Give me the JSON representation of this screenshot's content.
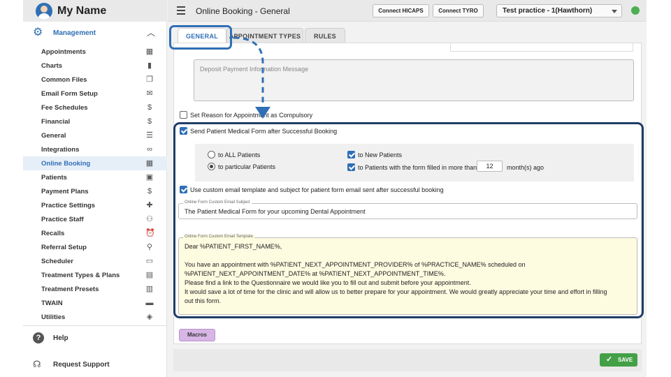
{
  "user": {
    "name": "My Name"
  },
  "sidebar": {
    "section_label": "Management",
    "items": [
      {
        "label": "Appointments",
        "icon": "calendar-icon"
      },
      {
        "label": "Charts",
        "icon": "bar-chart-icon"
      },
      {
        "label": "Common Files",
        "icon": "files-icon"
      },
      {
        "label": "Email Form Setup",
        "icon": "envelope-open-icon"
      },
      {
        "label": "Fee Schedules",
        "icon": "dollar-box-icon"
      },
      {
        "label": "Financial",
        "icon": "dollar-icon"
      },
      {
        "label": "General",
        "icon": "sliders-icon"
      },
      {
        "label": "Integrations",
        "icon": "link-icon"
      },
      {
        "label": "Online Booking",
        "icon": "calendar-icon",
        "active": true
      },
      {
        "label": "Patients",
        "icon": "contact-icon"
      },
      {
        "label": "Payment Plans",
        "icon": "dollar-icon"
      },
      {
        "label": "Practice Settings",
        "icon": "first-aid-icon"
      },
      {
        "label": "Practice Staff",
        "icon": "people-icon"
      },
      {
        "label": "Recalls",
        "icon": "alarm-icon"
      },
      {
        "label": "Referral Setup",
        "icon": "stamp-icon"
      },
      {
        "label": "Scheduler",
        "icon": "calendar-blank-icon"
      },
      {
        "label": "Treatment Types & Plans",
        "icon": "clipboard-icon"
      },
      {
        "label": "Treatment Presets",
        "icon": "list-box-icon"
      },
      {
        "label": "TWAIN",
        "icon": "scanner-icon"
      },
      {
        "label": "Utilities",
        "icon": "widgets-icon"
      }
    ],
    "help_label": "Help",
    "support_label": "Request Support"
  },
  "header": {
    "title": "Online Booking - General",
    "hicaps_label": "Connect HICAPS",
    "tyro_label": "Connect TYRO",
    "practice_selected": "Test practice - 1(Hawthorn)"
  },
  "tabs": [
    {
      "label": "GENERAL",
      "active": true
    },
    {
      "label": "APPOINTMENT TYPES",
      "active": false
    },
    {
      "label": "RULES",
      "active": false
    }
  ],
  "form": {
    "deposit_placeholder": "Deposit Payment Information Message",
    "set_reason_label": "Set Reason for Appointment as Compulsory",
    "set_reason_checked": false,
    "send_form_label": "Send Patient Medical Form after Successful Booking",
    "send_form_checked": true,
    "radio_all_label": "to ALL Patients",
    "radio_particular_label": "to particular Patients",
    "radio_selected": "particular",
    "new_patients_label": "to New Patients",
    "new_patients_checked": true,
    "filled_label": "to Patients with the form filled in more than",
    "filled_checked": true,
    "months_value": "12",
    "months_suffix": "month(s) ago",
    "custom_template_label": "Use custom email template and subject for patient form email sent after successful booking",
    "custom_template_checked": true,
    "subject_field_label": "Online Form Custom Email Subject",
    "subject_value": "The Patient Medical Form for your upcoming Dental Appointment",
    "template_field_label": "Online Form Custom Email Template",
    "template_lines": {
      "l1": "Dear %PATIENT_FIRST_NAME%,",
      "l2": "You have an appointment with %PATIENT_NEXT_APPOINTMENT_PROVIDER% of %PRACTICE_NAME% scheduled on",
      "l3": "%PATIENT_NEXT_APPOINTMENT_DATE% at %PATIENT_NEXT_APPOINTMENT_TIME%.",
      "l4": "Please find a link to the Questionnaire we would like you to fill out and submit before your appointment.",
      "l5": "It would save a lot of time for the clinic and will allow us to better prepare for your appointment. We would greatly appreciate your time and effort in filling",
      "l6": "out this form."
    },
    "macros_label": "Macros"
  },
  "footer": {
    "save_label": "SAVE"
  },
  "colors": {
    "accent": "#2f6fb5",
    "highlight": "#1f3e66",
    "save": "#43a047",
    "macros": "#d7b6e6",
    "template_bg": "#fdfbe0"
  }
}
